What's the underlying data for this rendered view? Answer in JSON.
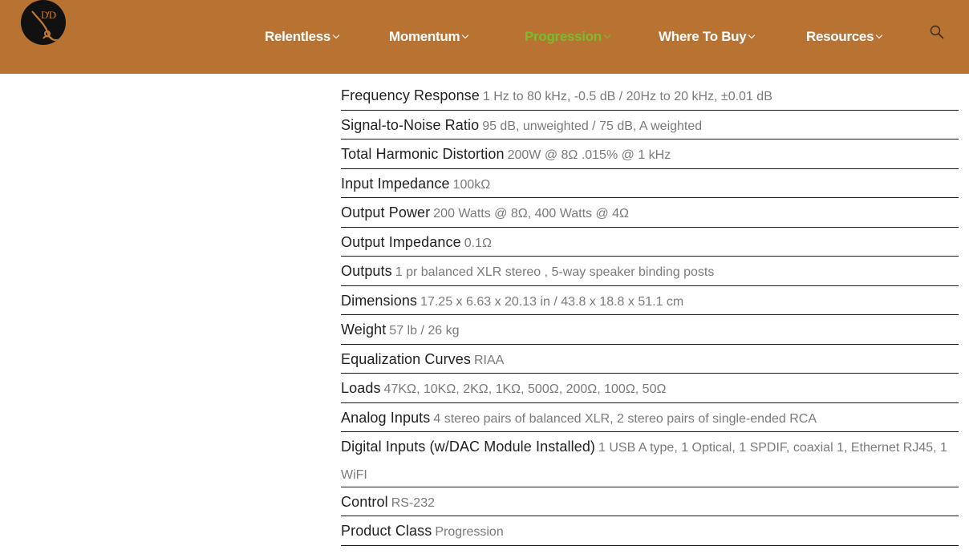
{
  "header": {
    "logo_text": "D'D",
    "nav": [
      {
        "label": "Relentless",
        "active": false
      },
      {
        "label": "Momentum",
        "active": false
      },
      {
        "label": "Progression",
        "active": true
      },
      {
        "label": "Where To Buy",
        "active": false
      },
      {
        "label": "Resources",
        "active": false
      }
    ],
    "search_icon": "search-icon"
  },
  "colors": {
    "header_bg": "#b87333",
    "active_nav": "#7dba2f",
    "label": "#222222",
    "value": "#7a7a7a"
  },
  "specs": [
    {
      "label": "Frequency Response",
      "value": "1 Hz to 80 kHz, -0.5 dB / 20Hz to 20 kHz, ±0.01 dB"
    },
    {
      "label": "Signal-to-Noise Ratio",
      "value": "95 dB, unweighted / 75 dB, A weighted"
    },
    {
      "label": "Total Harmonic Distortion",
      "value": "200W @ 8Ω .015% @ 1 kHz"
    },
    {
      "label": "Input Impedance",
      "value": "100kΩ"
    },
    {
      "label": "Output Power",
      "value": "200 Watts @ 8Ω, 400 Watts @ 4Ω"
    },
    {
      "label": "Output Impedance",
      "value": "0.1Ω"
    },
    {
      "label": "Outputs",
      "value": "1 pr balanced XLR stereo , 5-way speaker binding posts"
    },
    {
      "label": "Dimensions",
      "value": "17.25 x 6.63 x 20.13 in / 43.8 x 18.8 x 51.1 cm"
    },
    {
      "label": "Weight",
      "value": "57 lb / 26 kg"
    },
    {
      "label": "Equalization Curves",
      "value": "RIAA"
    },
    {
      "label": "Loads",
      "value": "47KΩ, 10KΩ, 2KΩ, 1KΩ, 500Ω, 200Ω, 100Ω, 50Ω"
    },
    {
      "label": "Analog Inputs",
      "value": "4 stereo pairs of balanced XLR, 2 stereo pairs of single-ended RCA"
    },
    {
      "label": "Digital Inputs (w/DAC Module Installed)",
      "value": "1 USB A type, 1 Optical, 1 SPDIF, coaxial 1, Ethernet RJ45, 1 WiFI"
    },
    {
      "label": "Control",
      "value": "RS-232"
    },
    {
      "label": "Product Class",
      "value": "Progression"
    }
  ]
}
